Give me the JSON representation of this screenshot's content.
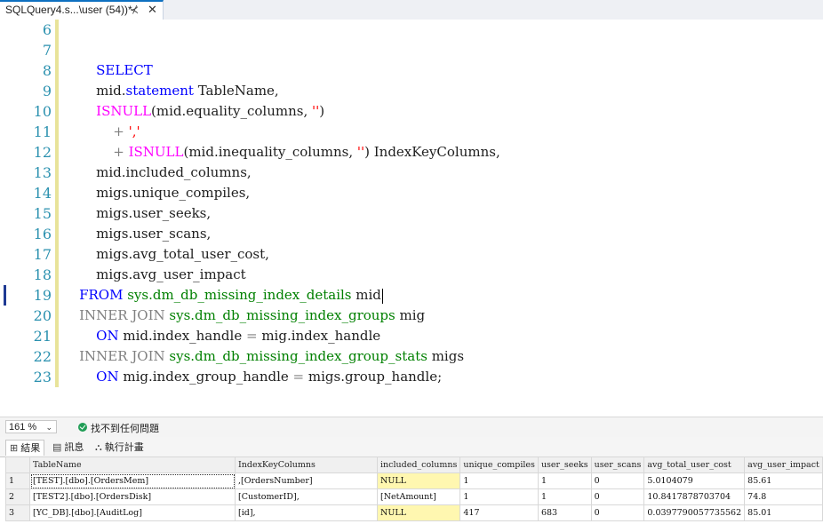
{
  "tab": {
    "title": "SQLQuery4.s...\\user (54))*",
    "pin_glyph": "⊀",
    "close_glyph": "✕"
  },
  "editor": {
    "lines": [
      {
        "num": "6",
        "segments": []
      },
      {
        "num": "7",
        "segments": []
      },
      {
        "num": "8",
        "segments": [
          {
            "t": "        "
          },
          {
            "t": "SELECT",
            "c": "kw"
          }
        ]
      },
      {
        "num": "9",
        "segments": [
          {
            "t": "        mid."
          },
          {
            "t": "statement",
            "c": "kw"
          },
          {
            "t": " TableName,"
          }
        ]
      },
      {
        "num": "10",
        "segments": [
          {
            "t": "        "
          },
          {
            "t": "ISNULL",
            "c": "fn"
          },
          {
            "t": "(mid.equality_columns, "
          },
          {
            "t": "''",
            "c": "str"
          },
          {
            "t": ")"
          }
        ]
      },
      {
        "num": "11",
        "segments": [
          {
            "t": "            "
          },
          {
            "t": "+",
            "c": "gr"
          },
          {
            "t": " "
          },
          {
            "t": "','",
            "c": "str"
          }
        ]
      },
      {
        "num": "12",
        "segments": [
          {
            "t": "            "
          },
          {
            "t": "+",
            "c": "gr"
          },
          {
            "t": " "
          },
          {
            "t": "ISNULL",
            "c": "fn"
          },
          {
            "t": "(mid.inequality_columns, "
          },
          {
            "t": "''",
            "c": "str"
          },
          {
            "t": ") IndexKeyColumns,"
          }
        ]
      },
      {
        "num": "13",
        "segments": [
          {
            "t": "        mid.included_columns,"
          }
        ]
      },
      {
        "num": "14",
        "segments": [
          {
            "t": "        migs.unique_compiles,"
          }
        ]
      },
      {
        "num": "15",
        "segments": [
          {
            "t": "        migs.user_seeks,"
          }
        ]
      },
      {
        "num": "16",
        "segments": [
          {
            "t": "        migs.user_scans,"
          }
        ]
      },
      {
        "num": "17",
        "segments": [
          {
            "t": "        migs.avg_total_user_cost,"
          }
        ]
      },
      {
        "num": "18",
        "segments": [
          {
            "t": "        migs.avg_user_impact"
          }
        ]
      },
      {
        "num": "19",
        "segments": [
          {
            "t": "    "
          },
          {
            "t": "FROM",
            "c": "kw"
          },
          {
            "t": " "
          },
          {
            "t": "sys.dm_db_missing_index_details",
            "c": "sys"
          },
          {
            "t": " mid"
          }
        ],
        "caret": true
      },
      {
        "num": "20",
        "segments": [
          {
            "t": "    "
          },
          {
            "t": "INNER JOIN",
            "c": "gr"
          },
          {
            "t": " "
          },
          {
            "t": "sys.dm_db_missing_index_groups",
            "c": "sys"
          },
          {
            "t": " mig"
          }
        ]
      },
      {
        "num": "21",
        "segments": [
          {
            "t": "        "
          },
          {
            "t": "ON",
            "c": "kw"
          },
          {
            "t": " mid.index_handle "
          },
          {
            "t": "=",
            "c": "gr"
          },
          {
            "t": " mig.index_handle"
          }
        ]
      },
      {
        "num": "22",
        "segments": [
          {
            "t": "    "
          },
          {
            "t": "INNER JOIN",
            "c": "gr"
          },
          {
            "t": " "
          },
          {
            "t": "sys.dm_db_missing_index_group_stats",
            "c": "sys"
          },
          {
            "t": " migs"
          }
        ]
      },
      {
        "num": "23",
        "segments": [
          {
            "t": "        "
          },
          {
            "t": "ON",
            "c": "kw"
          },
          {
            "t": " mig.index_group_handle "
          },
          {
            "t": "=",
            "c": "gr"
          },
          {
            "t": " migs.group_handle;"
          }
        ]
      }
    ]
  },
  "status": {
    "zoom": "161 %",
    "message": "找不到任何問題"
  },
  "result_tabs": [
    {
      "label": "結果",
      "icon": "grid-icon",
      "glyph": "⊞"
    },
    {
      "label": "訊息",
      "icon": "message-icon",
      "glyph": "▤"
    },
    {
      "label": "執行計畫",
      "icon": "execution-plan-icon",
      "glyph": "⛬"
    }
  ],
  "grid": {
    "columns": [
      "TableName",
      "IndexKeyColumns",
      "included_columns",
      "unique_compiles",
      "user_seeks",
      "user_scans",
      "avg_total_user_cost",
      "avg_user_impact"
    ],
    "rows": [
      {
        "rn": "1",
        "cells": [
          "[TEST].[dbo].[OrdersMem]",
          ",[OrdersNumber]",
          "NULL",
          "1",
          "1",
          "0",
          "5.0104079",
          "85.61"
        ]
      },
      {
        "rn": "2",
        "cells": [
          "[TEST2].[dbo].[OrdersDisk]",
          "[CustomerID],",
          "[NetAmount]",
          "1",
          "1",
          "0",
          "10.8417878703704",
          "74.8"
        ]
      },
      {
        "rn": "3",
        "cells": [
          "[YC_DB].[dbo].[AuditLog]",
          "[id],",
          "NULL",
          "417",
          "683",
          "0",
          "0.0397790057735562",
          "85.01"
        ]
      }
    ]
  }
}
